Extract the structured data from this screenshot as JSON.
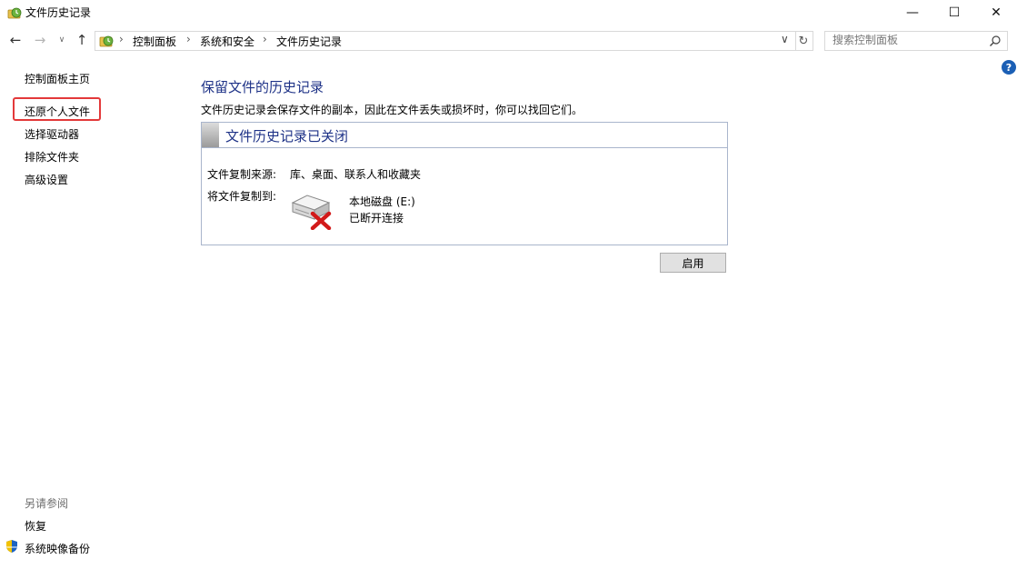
{
  "window": {
    "title": "文件历史记录",
    "controls": {
      "minimize": "—",
      "maximize": "☐",
      "close": "✕"
    }
  },
  "nav": {
    "back": "←",
    "forward": "→",
    "recent": "∨",
    "up": "↑",
    "dropdown": "∨",
    "refresh": "↻",
    "breadcrumb_sep": "›",
    "breadcrumbs": [
      "控制面板",
      "系统和安全",
      "文件历史记录"
    ]
  },
  "search": {
    "placeholder": "搜索控制面板"
  },
  "help": {
    "label": "?"
  },
  "sidebar": {
    "home": "控制面板主页",
    "items": [
      "还原个人文件",
      "选择驱动器",
      "排除文件夹",
      "高级设置"
    ],
    "highlighted_item": "还原个人文件",
    "see_also_title": "另请参阅",
    "see_also": [
      "恢复",
      "系统映像备份"
    ]
  },
  "main": {
    "heading": "保留文件的历史记录",
    "description": "文件历史记录会保存文件的副本，因此在文件丢失或损坏时，你可以找回它们。",
    "status_title": "文件历史记录已关闭",
    "copy_from_label": "文件复制来源:",
    "copy_from_value": "库、桌面、联系人和收藏夹",
    "copy_to_label": "将文件复制到:",
    "drive_name": "本地磁盘 (E:)",
    "drive_status": "已断开连接",
    "enable_button": "启用"
  },
  "colors": {
    "heading": "#1e3287",
    "highlight": "#e3393a",
    "panel_border": "#a9b5cc",
    "help_icon": "#1b5fb5"
  }
}
